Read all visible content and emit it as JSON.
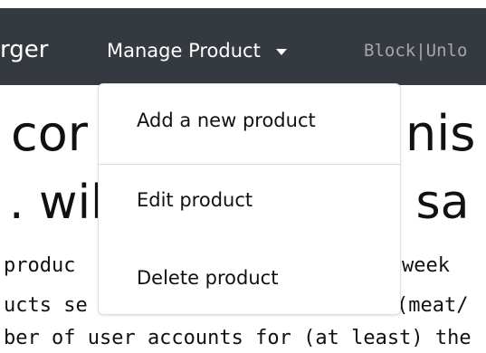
{
  "navbar": {
    "brand_fragment": "rger",
    "manage_product_label": "Manage Product",
    "block_unblock_label": "Block|Unlo"
  },
  "dropdown": {
    "items": [
      {
        "label": "Add a new product"
      },
      {
        "label": "Edit product"
      },
      {
        "label": "Delete product"
      }
    ]
  },
  "content": {
    "headline_1_left": "cor",
    "headline_1_right": "inis",
    "headline_2_left": ". wil",
    "headline_2_right": "d sa",
    "paragraph_line_1_left": "produc",
    "paragraph_line_1_right": "week",
    "paragraph_line_2_left": "ucts se",
    "paragraph_line_2_right": "(meat/",
    "paragraph_line_3": "ber of user accounts for (at least) the"
  },
  "colors": {
    "navbar_bg": "#343a40",
    "nav_text": "#ffffff",
    "nav_muted_text": "rgba(255,255,255,0.55)",
    "dropdown_bg": "#ffffff",
    "page_text": "#111111"
  },
  "icons": {
    "manage_dropdown_caret": "caret-down-icon"
  }
}
